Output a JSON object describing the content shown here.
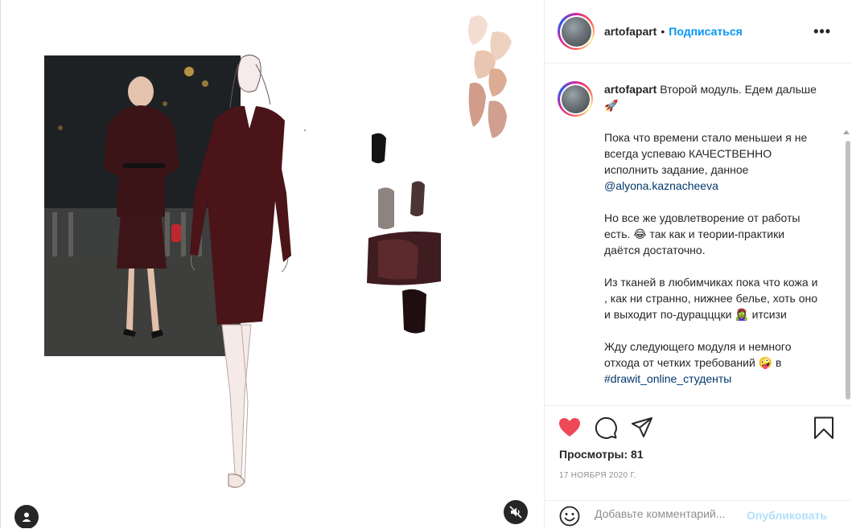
{
  "post": {
    "username": "artofapart",
    "follow_label": "Подписаться",
    "separator": "•",
    "more_label": "•••",
    "caption": {
      "username": "artofapart",
      "line1": "Второй модуль. Едем дальше 🚀",
      "p2": "Пока что времени стало меньшеи я не всегда успеваю КАЧЕСТВЕННО исполнить задание, данное",
      "p2_mention": "@alyona.kaznacheeva",
      "p3": "Но все же удовлетворение от работы есть. 😂 так как и теории-практики даётся достаточно.",
      "p4": "Из тканей в любимчиках пока что кожа и , как ни странно, нижнее белье, хоть оно и выходит по-дурацццки 🧟‍♀️ итсизи",
      "p5": "Жду следующего модуля и немного отхода от четких требований 🤪 в",
      "p5_hashtag": "#drawit_online_студенты"
    },
    "views_label": "Просмотры: 81",
    "date": "17 НОЯБРЯ 2020 Г.",
    "comment_placeholder": "Добавьте комментарий...",
    "publish_label": "Опубликовать"
  },
  "icons": {
    "like": "heart-icon",
    "comment": "comment-icon",
    "share": "share-icon",
    "save": "bookmark-icon",
    "emoji": "emoji-icon",
    "mute": "muted-speaker-icon",
    "tags": "user-tag-icon"
  },
  "colors": {
    "like_red": "#ed4956",
    "link_blue": "#0095f6",
    "mention": "#00376b",
    "burgundy_dress": "#4a1418"
  }
}
